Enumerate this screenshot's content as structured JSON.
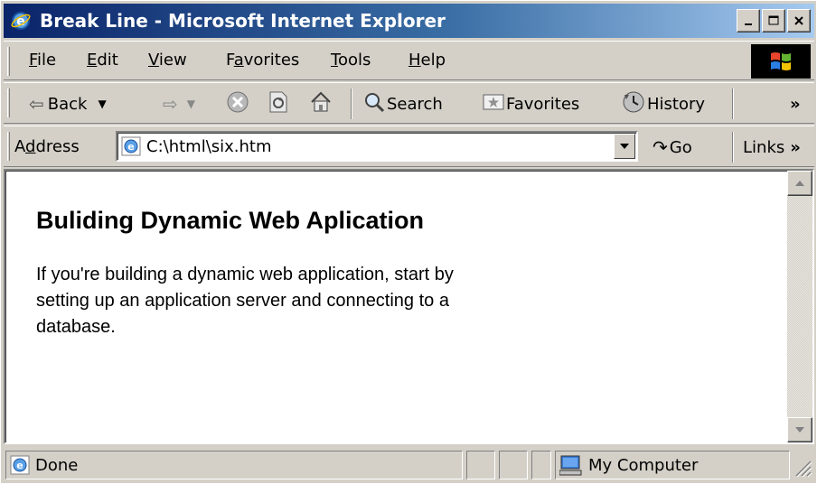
{
  "window": {
    "title": "Break Line - Microsoft Internet Explorer"
  },
  "menubar": {
    "items": [
      {
        "label": "File",
        "key": "F",
        "rest": "ile"
      },
      {
        "label": "Edit",
        "key": "E",
        "rest": "dit"
      },
      {
        "label": "View",
        "key": "V",
        "rest": "iew"
      },
      {
        "label": "Favorites",
        "pre": "F",
        "key": "a",
        "rest": "vorites"
      },
      {
        "label": "Tools",
        "key": "T",
        "rest": "ools"
      },
      {
        "label": "Help",
        "key": "H",
        "rest": "elp"
      }
    ]
  },
  "toolbar": {
    "back_label": "Back",
    "search_label": "Search",
    "favorites_label": "Favorites",
    "history_label": "History",
    "chevron": "»"
  },
  "address": {
    "label_pre": "A",
    "label_key": "d",
    "label_rest": "dress",
    "value": "C:\\html\\six.htm",
    "go_label": "Go",
    "links_label": "Links",
    "chevron": "»"
  },
  "content": {
    "heading": "Buliding Dynamic Web Aplication",
    "paragraph": "If you're building a dynamic web application, start by setting up an application server and connecting to a database."
  },
  "status": {
    "text": "Done",
    "zone": "My Computer"
  },
  "colors": {
    "titlebar_start": "#0a246a",
    "titlebar_end": "#a6caf0",
    "chrome": "#d4d0c8"
  }
}
